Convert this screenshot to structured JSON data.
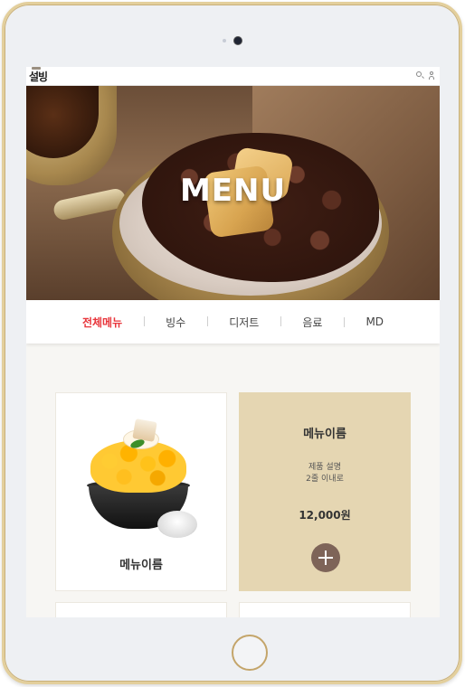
{
  "header": {
    "logo_text": "설빙",
    "icons": [
      "search-icon",
      "user-icon"
    ]
  },
  "hero": {
    "title": "MENU"
  },
  "categories": {
    "items": [
      {
        "label": "전체메뉴",
        "active": true
      },
      {
        "label": "빙수",
        "active": false
      },
      {
        "label": "디저트",
        "active": false
      },
      {
        "label": "음료",
        "active": false
      },
      {
        "label": "MD",
        "active": false
      }
    ],
    "active_color": "#e8363c"
  },
  "menu": {
    "item_card": {
      "name": "메뉴이름"
    },
    "detail_card": {
      "name": "메뉴이름",
      "description_line1": "제품 설명",
      "description_line2": "2줄 이내로",
      "price": "12,000원",
      "add_icon": "plus-icon",
      "background": "#e5d6b2",
      "button_color": "#7e6458"
    }
  }
}
